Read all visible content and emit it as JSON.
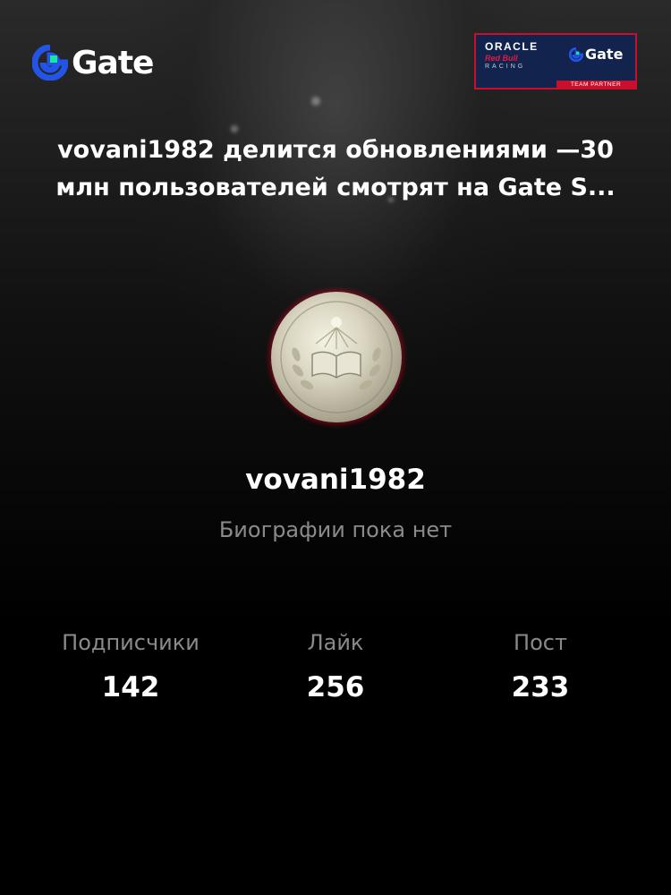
{
  "brand": {
    "name": "Gate",
    "accent": "#2354e6",
    "green": "#17e5a1"
  },
  "partner_badge": {
    "line1": "ORACLE",
    "line2": "Red Bull",
    "line3": "RACING",
    "brand": "Gate",
    "tag": "TEAM PARTNER"
  },
  "headline": "vovani1982 делится обновлениями —30 млн пользователей смотрят на Gate S...",
  "profile": {
    "avatar_icon": "medal-avatar",
    "username": "vovani1982",
    "bio": "Биографии пока нет"
  },
  "stats": [
    {
      "label": "Подписчики",
      "value": "142"
    },
    {
      "label": "Лайк",
      "value": "256"
    },
    {
      "label": "Пост",
      "value": "233"
    }
  ]
}
